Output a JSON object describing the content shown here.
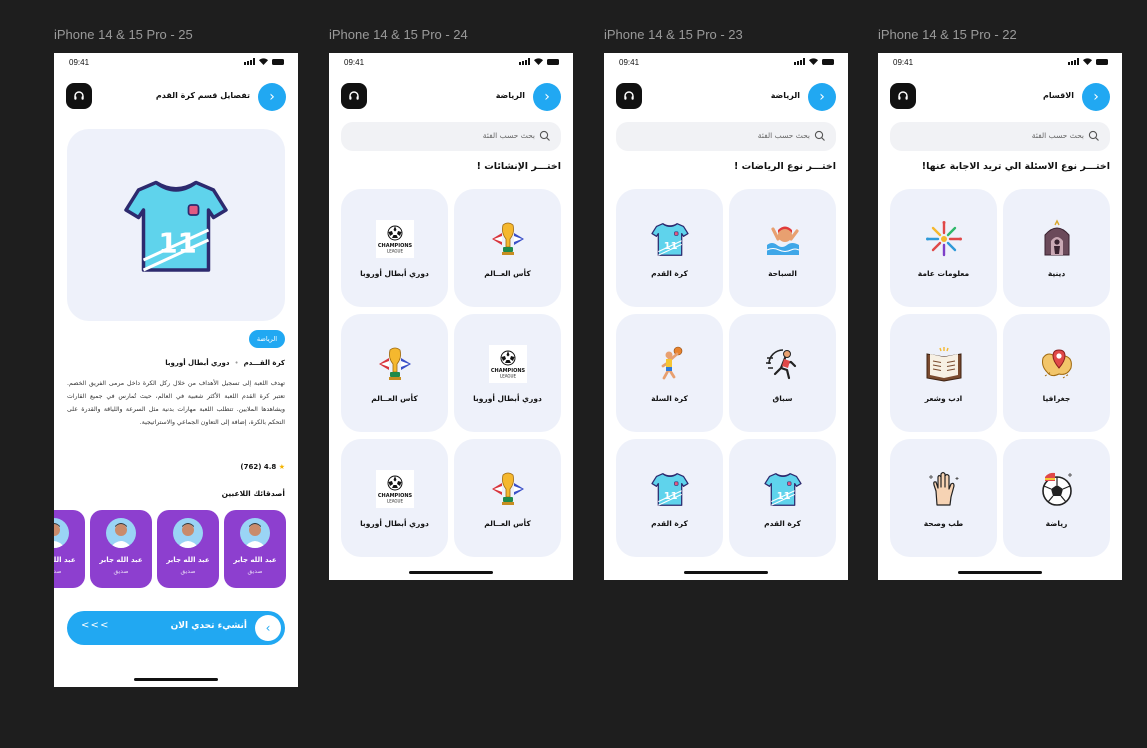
{
  "colors": {
    "accent": "#21a8f2",
    "card_bg": "#eef1fa",
    "friend_card": "#8d3fcf",
    "canvas": "#1e1e1e"
  },
  "status": {
    "time": "09:41"
  },
  "frames": [
    {
      "label": "iPhone 14 & 15 Pro - 25",
      "title": "تفصايل قسم كرة القدم",
      "hero_icon": "jersey-11-icon",
      "tag": "الرياضة",
      "crumb_first": "كرة القـــدم",
      "crumb_second": "دوري أبطال أوروبا",
      "description": "تهدف اللعبة إلى تسجيل الأهداف من خلال ركل الكرة داخل مرمى الفريق الخصم. تعتبر كرة القدم اللعبة الأكثر شعبية في العالم، حيث تُمارس في جميع القارات ويشاهدها الملايين. تتطلب اللعبة مهارات بدنية مثل السرعة واللياقة والقدرة على التحكم بالكرة، إضافة إلى التعاون الجماعي والاستراتيجية.",
      "rating": "4.8",
      "rating_count": "(762)",
      "friends_title": "أصدقائك اللاعبين",
      "friends": [
        {
          "name": "عبد الله جابر",
          "role": "صديق"
        },
        {
          "name": "عبد الله جابر",
          "role": "صديق"
        },
        {
          "name": "عبد الله جابر",
          "role": "صديق"
        },
        {
          "name": "عبد الله جابر",
          "role": "صديق"
        }
      ],
      "cta": "أنشيء تحدي الان",
      "cta_arrows": "< < <"
    },
    {
      "label": "iPhone 14 & 15 Pro - 24",
      "title": "الرياضة",
      "search_placeholder": "بحث حسب الفئة",
      "section_title": "اختـــر الإنشائات !",
      "cards": [
        {
          "label": "كأس العــالم",
          "icon": "world-cup-trophy-icon"
        },
        {
          "label": "دوري أبطال أوروبا",
          "icon": "champions-league-logo-icon"
        },
        {
          "label": "دوري أبطال أوروبا",
          "icon": "champions-league-logo-icon"
        },
        {
          "label": "كأس العــالم",
          "icon": "world-cup-trophy-icon"
        },
        {
          "label": "كأس العــالم",
          "icon": "world-cup-trophy-icon"
        },
        {
          "label": "دوري أبطال أوروبا",
          "icon": "champions-league-logo-icon"
        }
      ],
      "ucl_text": "CHAMPIONS LEAGUE"
    },
    {
      "label": "iPhone 14 & 15 Pro - 23",
      "title": "الرياضة",
      "search_placeholder": "بحث حسب الفئة",
      "section_title": "اختـــر نوع الرياضات !",
      "cards": [
        {
          "label": "السباحة",
          "icon": "swimming-icon"
        },
        {
          "label": "كرة القدم",
          "icon": "jersey-11-icon"
        },
        {
          "label": "سباق",
          "icon": "running-icon"
        },
        {
          "label": "كرة السلة",
          "icon": "basketball-player-icon"
        },
        {
          "label": "كرة القدم",
          "icon": "jersey-11-icon"
        },
        {
          "label": "كرة القدم",
          "icon": "jersey-11-icon"
        }
      ]
    },
    {
      "label": "iPhone 14 & 15 Pro - 22",
      "title": "الاقسام",
      "search_placeholder": "بحث حسب الفئة",
      "section_title": "اختـــر نوع الاسئلة الي تريد الاجابة عنها!",
      "cards": [
        {
          "label": "دينية",
          "icon": "mosque-icon"
        },
        {
          "label": "معلومات عامة",
          "icon": "idea-burst-icon"
        },
        {
          "label": "جغرافيا",
          "icon": "map-pin-icon"
        },
        {
          "label": "ادب وشعر",
          "icon": "open-book-icon"
        },
        {
          "label": "رياضة",
          "icon": "soccer-ball-icon"
        },
        {
          "label": "طب وصحة",
          "icon": "hand-icon"
        }
      ]
    }
  ]
}
